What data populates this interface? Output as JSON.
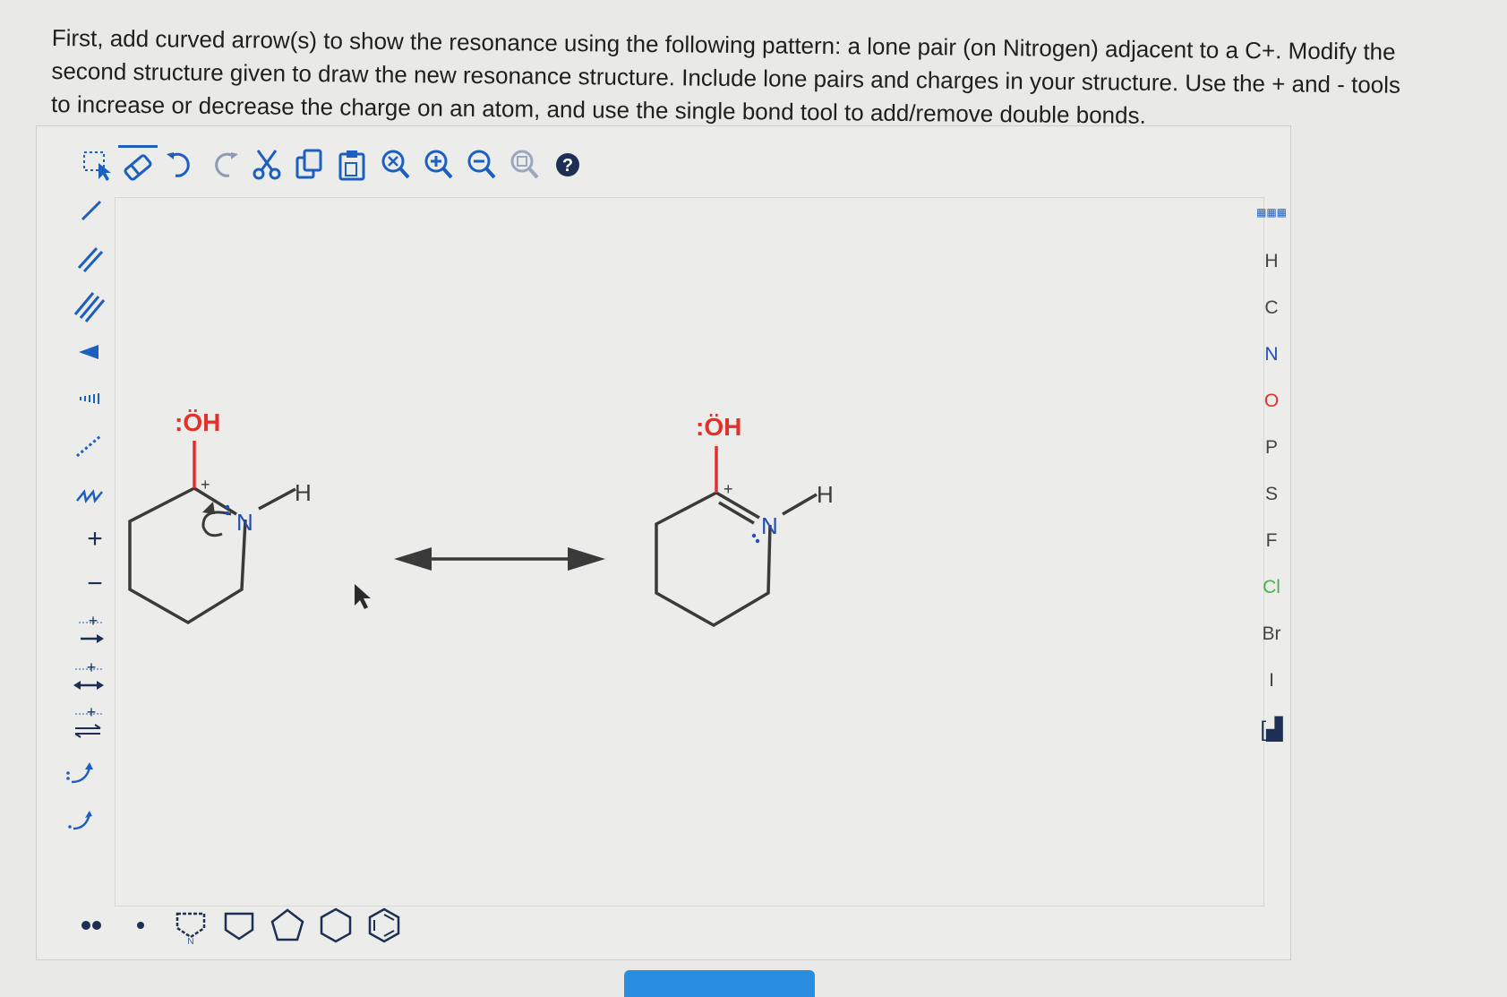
{
  "question": {
    "text": "First, add curved arrow(s) to show the resonance using the following pattern: a lone pair (on Nitrogen) adjacent to a C+. Modify the second structure given to draw the new resonance structure. Include lone pairs and charges in your structure. Use the + and - tools to increase or decrease the charge on an atom, and use the single bond tool to add/remove double bonds."
  },
  "toolbar": {
    "buttons": [
      "select-tool",
      "eraser-tool",
      "undo",
      "redo",
      "cut",
      "copy",
      "paste",
      "zoom-fit",
      "zoom-in",
      "zoom-out",
      "zoom-reset",
      "help"
    ],
    "help_label": "?"
  },
  "left_tools": [
    "single-bond",
    "double-bond",
    "triple-bond",
    "wedge-bond",
    "hash-bond",
    "dashed-bond",
    "wavy-bond",
    "plus-charge",
    "minus-charge",
    "forward-arrow",
    "resonance-arrow",
    "equilibrium-arrow",
    "curved-arrow-single",
    "curved-arrow-double"
  ],
  "left_tool_labels": {
    "plus": "+",
    "minus": "−"
  },
  "elements": {
    "items": [
      "H",
      "C",
      "N",
      "O",
      "P",
      "S",
      "F",
      "Cl",
      "Br",
      "I"
    ],
    "colors": {
      "H": "#555555",
      "C": "#555555",
      "N": "#1f4fb3",
      "O": "#e2302a",
      "P": "#555555",
      "S": "#555555",
      "F": "#555555",
      "Cl": "#4caf50",
      "Br": "#555555",
      "I": "#555555"
    }
  },
  "structure1": {
    "oh_label": ":ÖH",
    "plus_charge": "+",
    "n_label": "N",
    "h_label": "H"
  },
  "structure2": {
    "oh_label": ":ÖH",
    "plus_charge": "+",
    "n_label": "N",
    "h_label": "H"
  },
  "colors": {
    "bond": "#3a3a3a",
    "oxygen": "#e2302a",
    "nitrogen": "#1f4fb3",
    "accent": "#1d5fbf",
    "submit": "#2a8ee0"
  }
}
